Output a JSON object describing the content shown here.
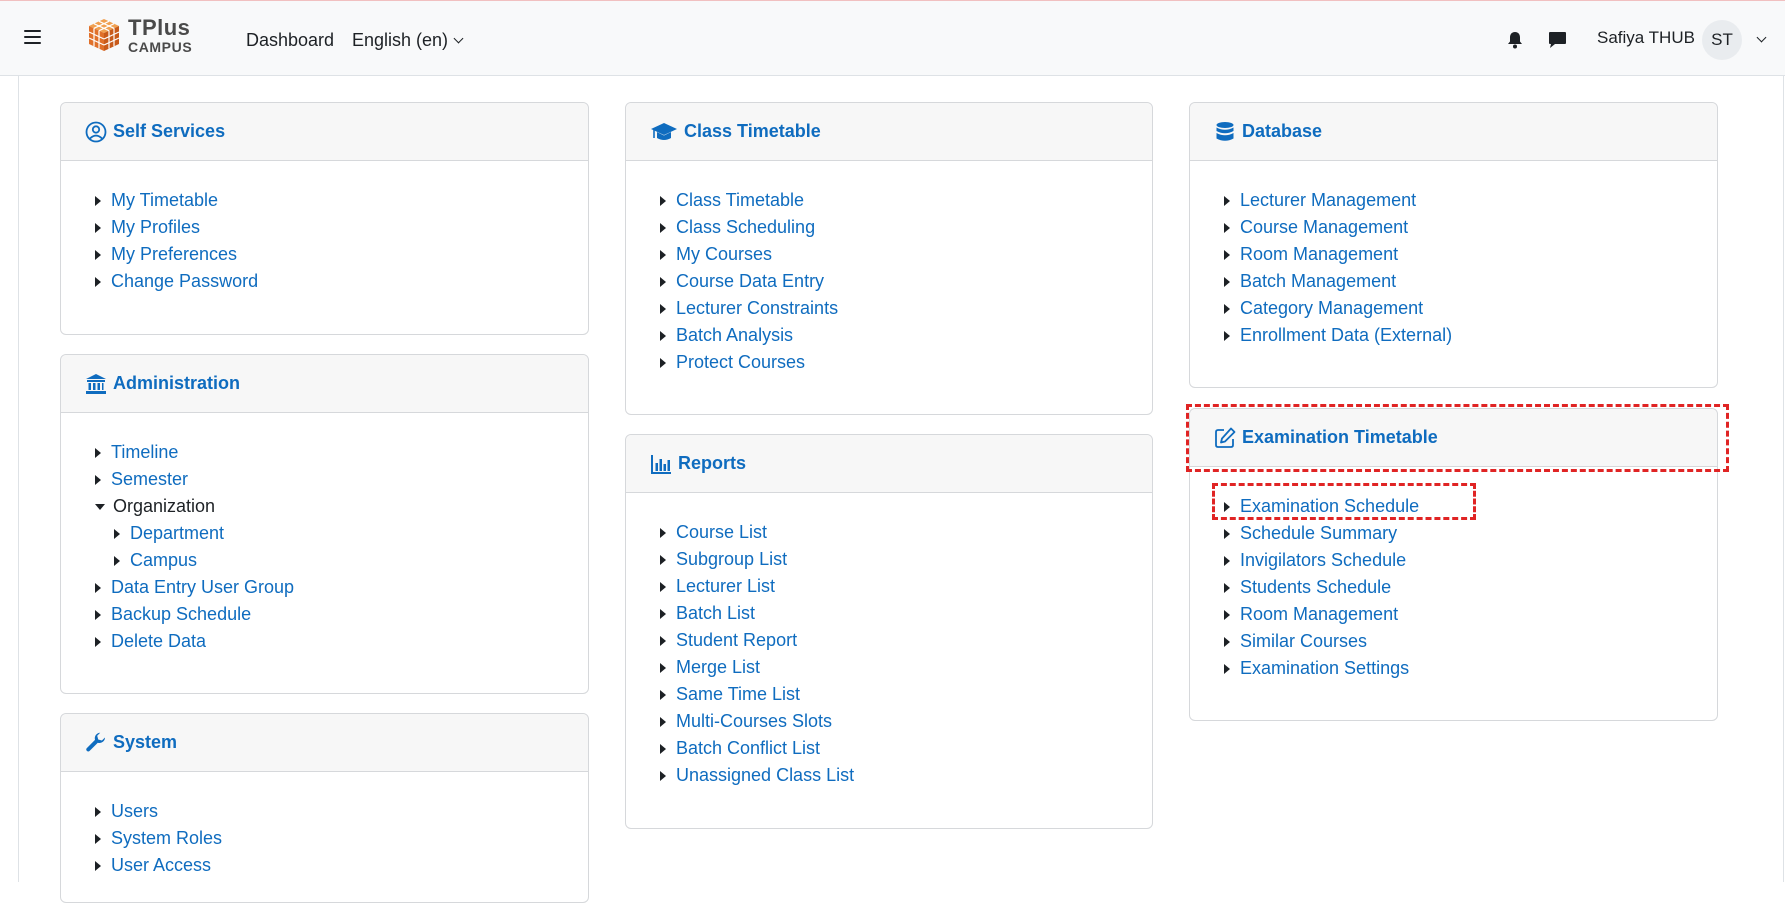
{
  "header": {
    "logo_title": "TPlus",
    "logo_subtitle": "CAMPUS",
    "dashboard_label": "Dashboard",
    "language_label": "English (en)",
    "user_name": "Safiya THUB",
    "avatar_initials": "ST"
  },
  "colors": {
    "link": "#0f6cbf",
    "highlight": "#e02424"
  },
  "self_services": {
    "title": "Self Services",
    "icon": "user-circle-icon",
    "items": [
      "My Timetable",
      "My Profiles",
      "My Preferences",
      "Change Password"
    ]
  },
  "administration": {
    "title": "Administration",
    "icon": "university-icon",
    "items": [
      "Timeline",
      "Semester",
      "Organization",
      "Department",
      "Campus",
      "Data Entry User Group",
      "Backup Schedule",
      "Delete Data"
    ]
  },
  "system": {
    "title": "System",
    "icon": "wrench-icon",
    "items": [
      "Users",
      "System Roles",
      "User Access"
    ]
  },
  "class_timetable": {
    "title": "Class Timetable",
    "icon": "graduation-cap-icon",
    "items": [
      "Class Timetable",
      "Class Scheduling",
      "My Courses",
      "Course Data Entry",
      "Lecturer Constraints",
      "Batch Analysis",
      "Protect Courses"
    ]
  },
  "reports": {
    "title": "Reports",
    "icon": "bar-chart-icon",
    "items": [
      "Course List",
      "Subgroup List",
      "Lecturer List",
      "Batch List",
      "Student Report",
      "Merge List",
      "Same Time List",
      "Multi-Courses Slots",
      "Batch Conflict List",
      "Unassigned Class List"
    ]
  },
  "database": {
    "title": "Database",
    "icon": "database-icon",
    "items": [
      "Lecturer Management",
      "Course Management",
      "Room Management",
      "Batch Management",
      "Category Management",
      "Enrollment Data (External)"
    ]
  },
  "exam_timetable": {
    "title": "Examination Timetable",
    "icon": "edit-icon",
    "items": [
      "Examination Schedule",
      "Schedule Summary",
      "Invigilators Schedule",
      "Students Schedule",
      "Room Management",
      "Similar Courses",
      "Examination Settings"
    ]
  }
}
